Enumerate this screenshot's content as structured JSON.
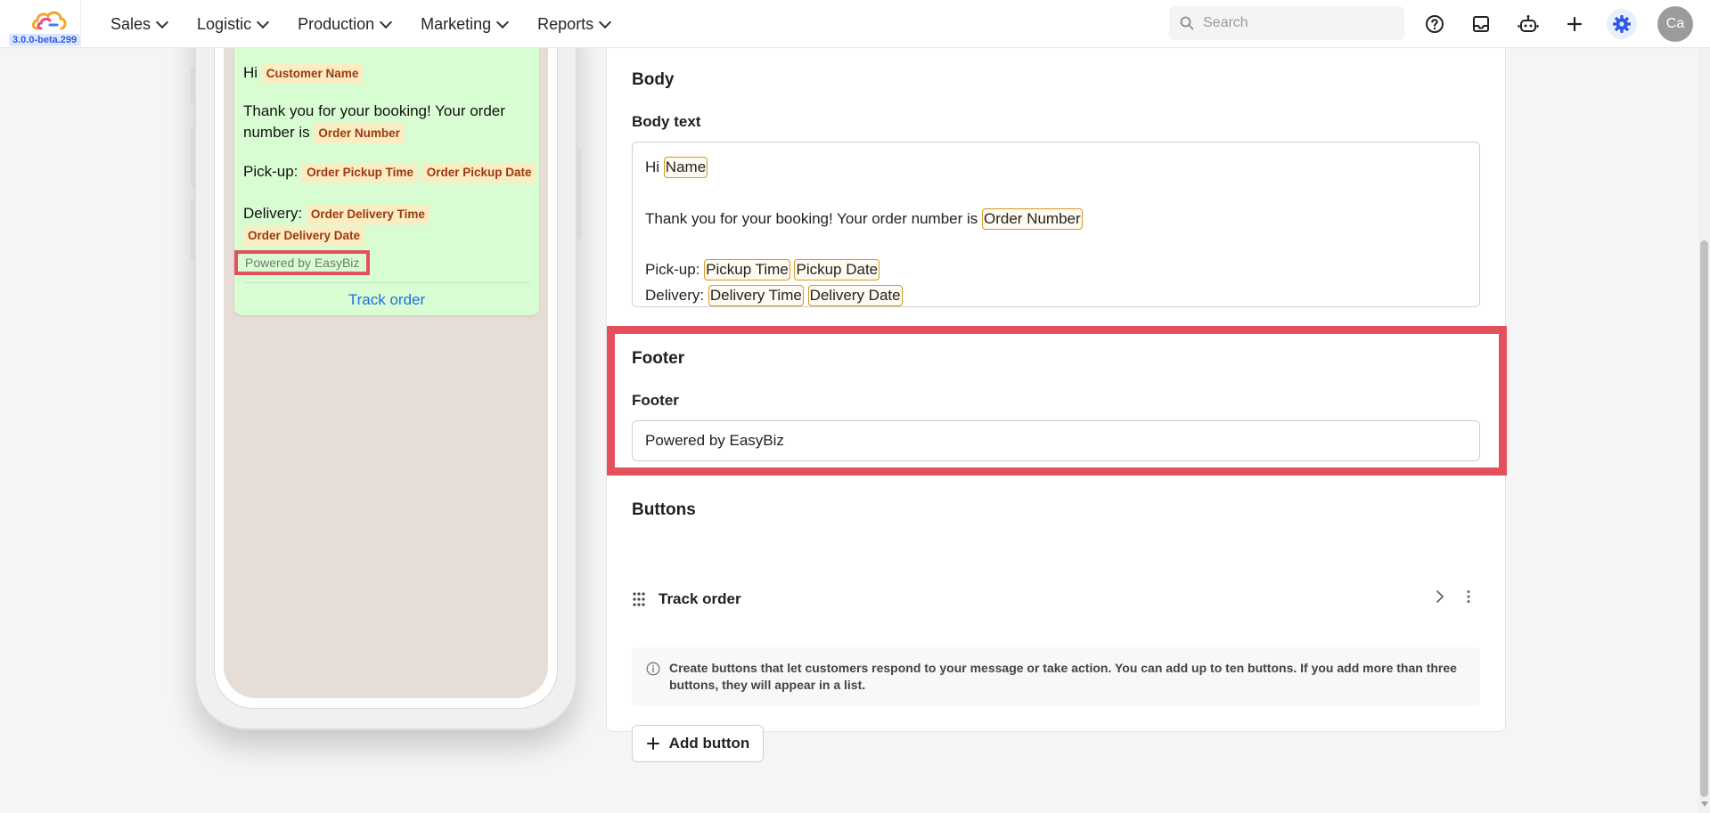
{
  "app": {
    "version": "3.0.0-beta.299",
    "colors": {
      "accent": "#2d5be3",
      "highlight": "#e4505c",
      "bubble": "#d9fdd3"
    }
  },
  "nav": {
    "items": [
      {
        "label": "Sales"
      },
      {
        "label": "Logistic"
      },
      {
        "label": "Production"
      },
      {
        "label": "Marketing"
      },
      {
        "label": "Reports"
      }
    ],
    "search_placeholder": "Search",
    "avatar_initials": "Ca",
    "icons": [
      "help-icon",
      "inbox-icon",
      "bot-icon",
      "plus-icon",
      "gear-icon"
    ]
  },
  "preview": {
    "greeting": "Hi",
    "customer_tag": "Customer Name",
    "thanks": "Thank you for your booking! Your order number is",
    "order_tag": "Order Number",
    "pickup_label": "Pick-up:",
    "pickup_time_tag": "Order Pickup Time",
    "pickup_date_tag": "Order Pickup Date",
    "delivery_label": "Delivery:",
    "delivery_time_tag": "Order Delivery Time",
    "delivery_date_tag": "Order Delivery Date",
    "footer": "Powered by EasyBiz",
    "button": "Track order"
  },
  "form": {
    "body": {
      "title": "Body",
      "label": "Body text",
      "hi": "Hi",
      "name_var": "Name",
      "thanks": "Thank you for your booking! Your order number is",
      "order_var": "Order Number",
      "pickup_label": "Pick-up:",
      "pickup_time_var": "Pickup Time",
      "pickup_date_var": "Pickup Date",
      "delivery_label": "Delivery:",
      "delivery_time_var": "Delivery Time",
      "delivery_date_var": "Delivery Date"
    },
    "footer": {
      "title": "Footer",
      "label": "Footer",
      "value": "Powered by EasyBiz"
    },
    "buttons": {
      "title": "Buttons",
      "items": [
        {
          "label": "Track order"
        }
      ],
      "info": "Create buttons that let customers respond to your message or take action. You can add up to ten buttons. If you add more than three buttons, they will appear in a list.",
      "add_label": "Add button"
    }
  }
}
